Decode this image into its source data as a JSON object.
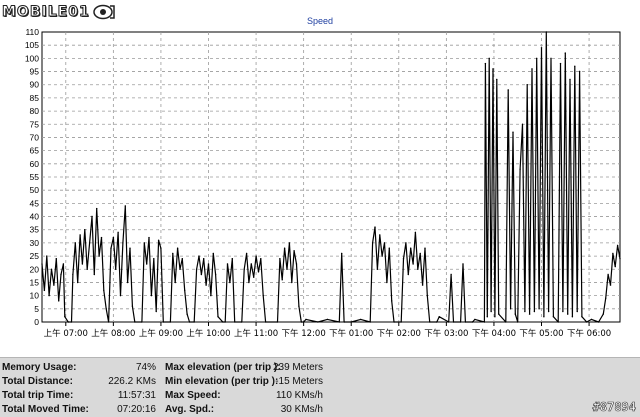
{
  "logo": {
    "text": "MOBILE01"
  },
  "watermark": "#87894",
  "chart_data": {
    "type": "line",
    "title": "Speed",
    "xlabel": "",
    "ylabel": "",
    "grid": true,
    "ylim": [
      0,
      110
    ],
    "yticks": [
      0,
      5,
      10,
      15,
      20,
      25,
      30,
      35,
      40,
      45,
      50,
      55,
      60,
      65,
      70,
      75,
      80,
      85,
      90,
      95,
      100,
      105,
      110
    ],
    "xlim": [
      6.5,
      18.65
    ],
    "xticks": [
      {
        "hour": 7,
        "label": "上午 07:00"
      },
      {
        "hour": 8,
        "label": "上午 08:00"
      },
      {
        "hour": 9,
        "label": "上午 09:00"
      },
      {
        "hour": 10,
        "label": "上午 10:00"
      },
      {
        "hour": 11,
        "label": "上午 11:00"
      },
      {
        "hour": 12,
        "label": "下午 12:00"
      },
      {
        "hour": 13,
        "label": "下午 01:00"
      },
      {
        "hour": 14,
        "label": "下午 02:00"
      },
      {
        "hour": 15,
        "label": "下午 03:00"
      },
      {
        "hour": 16,
        "label": "下午 04:00"
      },
      {
        "hour": 17,
        "label": "下午 05:00"
      },
      {
        "hour": 18,
        "label": "下午 06:00"
      }
    ],
    "series": [
      {
        "color": "#000000",
        "points": [
          [
            6.5,
            22
          ],
          [
            6.55,
            12
          ],
          [
            6.6,
            25
          ],
          [
            6.65,
            10
          ],
          [
            6.7,
            20
          ],
          [
            6.75,
            14
          ],
          [
            6.8,
            24
          ],
          [
            6.85,
            8
          ],
          [
            6.9,
            18
          ],
          [
            6.95,
            22
          ],
          [
            6.98,
            2
          ],
          [
            7.05,
            0
          ],
          [
            7.12,
            0
          ],
          [
            7.15,
            18
          ],
          [
            7.2,
            30
          ],
          [
            7.25,
            15
          ],
          [
            7.3,
            33
          ],
          [
            7.35,
            22
          ],
          [
            7.4,
            35
          ],
          [
            7.45,
            20
          ],
          [
            7.5,
            30
          ],
          [
            7.55,
            40
          ],
          [
            7.6,
            18
          ],
          [
            7.65,
            43
          ],
          [
            7.7,
            25
          ],
          [
            7.75,
            32
          ],
          [
            7.8,
            12
          ],
          [
            7.85,
            5
          ],
          [
            7.9,
            0
          ],
          [
            7.95,
            28
          ],
          [
            8.0,
            32
          ],
          [
            8.05,
            20
          ],
          [
            8.1,
            34
          ],
          [
            8.15,
            10
          ],
          [
            8.2,
            30
          ],
          [
            8.25,
            44
          ],
          [
            8.3,
            15
          ],
          [
            8.35,
            28
          ],
          [
            8.4,
            6
          ],
          [
            8.45,
            0
          ],
          [
            8.6,
            0
          ],
          [
            8.65,
            30
          ],
          [
            8.7,
            22
          ],
          [
            8.75,
            32
          ],
          [
            8.8,
            10
          ],
          [
            8.85,
            24
          ],
          [
            8.9,
            4
          ],
          [
            8.95,
            31
          ],
          [
            9.0,
            28
          ],
          [
            9.05,
            0
          ],
          [
            9.2,
            0
          ],
          [
            9.25,
            26
          ],
          [
            9.3,
            15
          ],
          [
            9.35,
            28
          ],
          [
            9.4,
            20
          ],
          [
            9.45,
            24
          ],
          [
            9.5,
            12
          ],
          [
            9.55,
            3
          ],
          [
            9.6,
            0
          ],
          [
            9.7,
            0
          ],
          [
            9.75,
            20
          ],
          [
            9.8,
            25
          ],
          [
            9.85,
            18
          ],
          [
            9.9,
            24
          ],
          [
            9.95,
            14
          ],
          [
            10.0,
            22
          ],
          [
            10.05,
            10
          ],
          [
            10.1,
            26
          ],
          [
            10.15,
            18
          ],
          [
            10.2,
            2
          ],
          [
            10.3,
            0
          ],
          [
            10.35,
            0
          ],
          [
            10.4,
            22
          ],
          [
            10.45,
            15
          ],
          [
            10.5,
            24
          ],
          [
            10.55,
            0
          ],
          [
            10.7,
            0
          ],
          [
            10.75,
            20
          ],
          [
            10.8,
            26
          ],
          [
            10.85,
            15
          ],
          [
            10.9,
            22
          ],
          [
            10.95,
            17
          ],
          [
            11.0,
            25
          ],
          [
            11.05,
            19
          ],
          [
            11.1,
            24
          ],
          [
            11.15,
            10
          ],
          [
            11.2,
            0
          ],
          [
            11.45,
            0
          ],
          [
            11.5,
            24
          ],
          [
            11.55,
            16
          ],
          [
            11.6,
            28
          ],
          [
            11.65,
            20
          ],
          [
            11.7,
            30
          ],
          [
            11.75,
            15
          ],
          [
            11.8,
            27
          ],
          [
            11.85,
            22
          ],
          [
            11.9,
            6
          ],
          [
            11.95,
            0
          ],
          [
            12.0,
            0
          ],
          [
            12.05,
            1
          ],
          [
            12.3,
            0
          ],
          [
            12.5,
            1
          ],
          [
            12.75,
            0
          ],
          [
            12.8,
            26
          ],
          [
            12.85,
            0
          ],
          [
            13.0,
            0
          ],
          [
            13.2,
            1
          ],
          [
            13.4,
            0
          ],
          [
            13.45,
            30
          ],
          [
            13.5,
            36
          ],
          [
            13.55,
            20
          ],
          [
            13.6,
            33
          ],
          [
            13.65,
            25
          ],
          [
            13.7,
            30
          ],
          [
            13.75,
            15
          ],
          [
            13.8,
            28
          ],
          [
            13.85,
            8
          ],
          [
            13.9,
            0
          ],
          [
            14.05,
            0
          ],
          [
            14.1,
            24
          ],
          [
            14.15,
            30
          ],
          [
            14.2,
            18
          ],
          [
            14.25,
            28
          ],
          [
            14.3,
            22
          ],
          [
            14.35,
            34
          ],
          [
            14.4,
            20
          ],
          [
            14.45,
            26
          ],
          [
            14.5,
            14
          ],
          [
            14.55,
            28
          ],
          [
            14.6,
            10
          ],
          [
            14.65,
            0
          ],
          [
            14.8,
            0
          ],
          [
            14.85,
            2
          ],
          [
            15.05,
            0
          ],
          [
            15.1,
            18
          ],
          [
            15.15,
            0
          ],
          [
            15.3,
            0
          ],
          [
            15.35,
            22
          ],
          [
            15.4,
            0
          ],
          [
            15.55,
            0
          ],
          [
            15.6,
            1
          ],
          [
            15.8,
            0
          ],
          [
            15.82,
            98
          ],
          [
            15.86,
            2
          ],
          [
            15.9,
            100
          ],
          [
            15.94,
            4
          ],
          [
            15.98,
            96
          ],
          [
            16.02,
            2
          ],
          [
            16.06,
            92
          ],
          [
            16.1,
            3
          ],
          [
            16.25,
            0
          ],
          [
            16.3,
            88
          ],
          [
            16.35,
            5
          ],
          [
            16.4,
            72
          ],
          [
            16.45,
            3
          ],
          [
            16.5,
            0
          ],
          [
            16.55,
            58
          ],
          [
            16.6,
            75
          ],
          [
            16.65,
            4
          ],
          [
            16.7,
            90
          ],
          [
            16.75,
            3
          ],
          [
            16.8,
            96
          ],
          [
            16.85,
            4
          ],
          [
            16.9,
            100
          ],
          [
            16.95,
            5
          ],
          [
            17.0,
            104
          ],
          [
            17.05,
            2
          ],
          [
            17.1,
            110
          ],
          [
            17.15,
            4
          ],
          [
            17.2,
            100
          ],
          [
            17.25,
            2
          ],
          [
            17.35,
            0
          ],
          [
            17.4,
            98
          ],
          [
            17.45,
            4
          ],
          [
            17.5,
            102
          ],
          [
            17.55,
            3
          ],
          [
            17.6,
            92
          ],
          [
            17.65,
            2
          ],
          [
            17.7,
            97
          ],
          [
            17.75,
            4
          ],
          [
            17.8,
            95
          ],
          [
            17.85,
            2
          ],
          [
            17.95,
            0
          ],
          [
            18.05,
            1
          ],
          [
            18.2,
            0
          ],
          [
            18.3,
            3
          ],
          [
            18.35,
            9
          ],
          [
            18.4,
            18
          ],
          [
            18.45,
            14
          ],
          [
            18.5,
            26
          ],
          [
            18.55,
            21
          ],
          [
            18.6,
            29
          ],
          [
            18.65,
            24
          ]
        ]
      }
    ]
  },
  "stats": {
    "memory_usage_label": "Memory Usage:",
    "memory_usage_value": "74%",
    "total_distance_label": "Total Distance:",
    "total_distance_value": "226.2 KMs",
    "total_trip_time_label": "Total trip Time:",
    "total_trip_time_value": "11:57:31",
    "total_moved_time_label": "Total Moved Time:",
    "total_moved_time_value": "07:20:16",
    "max_elevation_label": "Max elevation (per trip ):",
    "max_elevation_value": "239 Meters",
    "min_elevation_label": "Min elevation (per trip ):",
    "min_elevation_value": "-15 Meters",
    "max_speed_label": "Max Speed:",
    "max_speed_value": "110 KMs/h",
    "avg_speed_label": "Avg. Spd.:",
    "avg_speed_value": "30 KMs/h"
  }
}
